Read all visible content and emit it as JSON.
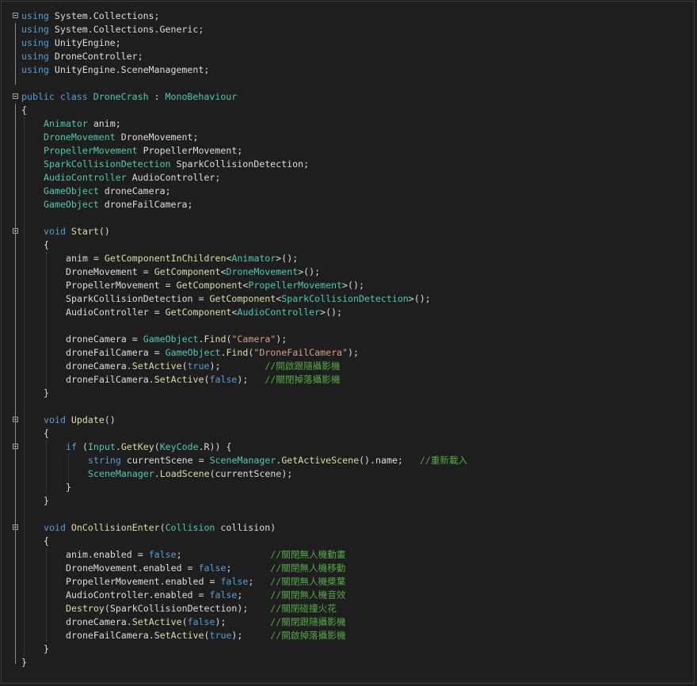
{
  "editor": {
    "lines": [
      [
        {
          "t": "using",
          "c": "kw"
        },
        {
          "t": " System.Collections;",
          "c": "pl"
        }
      ],
      [
        {
          "t": "using",
          "c": "kw"
        },
        {
          "t": " System.Collections.Generic;",
          "c": "pl"
        }
      ],
      [
        {
          "t": "using",
          "c": "kw"
        },
        {
          "t": " UnityEngine;",
          "c": "pl"
        }
      ],
      [
        {
          "t": "using",
          "c": "kw"
        },
        {
          "t": " DroneController;",
          "c": "pl"
        }
      ],
      [
        {
          "t": "using",
          "c": "kw"
        },
        {
          "t": " UnityEngine.SceneManagement;",
          "c": "pl"
        }
      ],
      [],
      [
        {
          "t": "public class ",
          "c": "kw"
        },
        {
          "t": "DroneCrash",
          "c": "ty"
        },
        {
          "t": " : ",
          "c": "pl"
        },
        {
          "t": "MonoBehaviour",
          "c": "ty"
        }
      ],
      [
        {
          "t": "{",
          "c": "pl"
        }
      ],
      [
        {
          "t": "Animator",
          "c": "ty"
        },
        {
          "t": " anim;",
          "c": "pl"
        }
      ],
      [
        {
          "t": "DroneMovement",
          "c": "ty"
        },
        {
          "t": " DroneMovement;",
          "c": "pl"
        }
      ],
      [
        {
          "t": "PropellerMovement",
          "c": "ty"
        },
        {
          "t": " PropellerMovement;",
          "c": "pl"
        }
      ],
      [
        {
          "t": "SparkCollisionDetection",
          "c": "ty"
        },
        {
          "t": " SparkCollisionDetection;",
          "c": "pl"
        }
      ],
      [
        {
          "t": "AudioController",
          "c": "ty"
        },
        {
          "t": " AudioController;",
          "c": "pl"
        }
      ],
      [
        {
          "t": "GameObject",
          "c": "ty"
        },
        {
          "t": " droneCamera;",
          "c": "pl"
        }
      ],
      [
        {
          "t": "GameObject",
          "c": "ty"
        },
        {
          "t": " droneFailCamera;",
          "c": "pl"
        }
      ],
      [],
      [
        {
          "t": "void ",
          "c": "kw"
        },
        {
          "t": "Start",
          "c": "fn"
        },
        {
          "t": "()",
          "c": "pl"
        }
      ],
      [
        {
          "t": "{",
          "c": "pl"
        }
      ],
      [
        {
          "t": "anim = ",
          "c": "pl"
        },
        {
          "t": "GetComponentInChildren",
          "c": "fn"
        },
        {
          "t": "<",
          "c": "pl"
        },
        {
          "t": "Animator",
          "c": "ty"
        },
        {
          "t": ">();",
          "c": "pl"
        }
      ],
      [
        {
          "t": "DroneMovement = ",
          "c": "pl"
        },
        {
          "t": "GetComponent",
          "c": "fn"
        },
        {
          "t": "<",
          "c": "pl"
        },
        {
          "t": "DroneMovement",
          "c": "ty"
        },
        {
          "t": ">();",
          "c": "pl"
        }
      ],
      [
        {
          "t": "PropellerMovement = ",
          "c": "pl"
        },
        {
          "t": "GetComponent",
          "c": "fn"
        },
        {
          "t": "<",
          "c": "pl"
        },
        {
          "t": "PropellerMovement",
          "c": "ty"
        },
        {
          "t": ">();",
          "c": "pl"
        }
      ],
      [
        {
          "t": "SparkCollisionDetection = ",
          "c": "pl"
        },
        {
          "t": "GetComponent",
          "c": "fn"
        },
        {
          "t": "<",
          "c": "pl"
        },
        {
          "t": "SparkCollisionDetection",
          "c": "ty"
        },
        {
          "t": ">();",
          "c": "pl"
        }
      ],
      [
        {
          "t": "AudioController = ",
          "c": "pl"
        },
        {
          "t": "GetComponent",
          "c": "fn"
        },
        {
          "t": "<",
          "c": "pl"
        },
        {
          "t": "AudioController",
          "c": "ty"
        },
        {
          "t": ">();",
          "c": "pl"
        }
      ],
      [],
      [
        {
          "t": "droneCamera = ",
          "c": "pl"
        },
        {
          "t": "GameObject",
          "c": "ty"
        },
        {
          "t": ".",
          "c": "pl"
        },
        {
          "t": "Find",
          "c": "fn"
        },
        {
          "t": "(",
          "c": "pl"
        },
        {
          "t": "\"Camera\"",
          "c": "st"
        },
        {
          "t": ");",
          "c": "pl"
        }
      ],
      [
        {
          "t": "droneFailCamera = ",
          "c": "pl"
        },
        {
          "t": "GameObject",
          "c": "ty"
        },
        {
          "t": ".",
          "c": "pl"
        },
        {
          "t": "Find",
          "c": "fn"
        },
        {
          "t": "(",
          "c": "pl"
        },
        {
          "t": "\"DroneFailCamera\"",
          "c": "st"
        },
        {
          "t": ");",
          "c": "pl"
        }
      ],
      [
        {
          "t": "droneCamera.",
          "c": "pl"
        },
        {
          "t": "SetActive",
          "c": "fn"
        },
        {
          "t": "(",
          "c": "pl"
        },
        {
          "t": "true",
          "c": "kw"
        },
        {
          "t": ");        ",
          "c": "pl"
        },
        {
          "t": "//開啟跟隨攝影機",
          "c": "cm"
        }
      ],
      [
        {
          "t": "droneFailCamera.",
          "c": "pl"
        },
        {
          "t": "SetActive",
          "c": "fn"
        },
        {
          "t": "(",
          "c": "pl"
        },
        {
          "t": "false",
          "c": "kw"
        },
        {
          "t": ");   ",
          "c": "pl"
        },
        {
          "t": "//關閉掉落攝影機",
          "c": "cm"
        }
      ],
      [
        {
          "t": "}",
          "c": "pl"
        }
      ],
      [],
      [
        {
          "t": "void ",
          "c": "kw"
        },
        {
          "t": "Update",
          "c": "fn"
        },
        {
          "t": "()",
          "c": "pl"
        }
      ],
      [
        {
          "t": "{",
          "c": "pl"
        }
      ],
      [
        {
          "t": "if",
          "c": "kw"
        },
        {
          "t": " (",
          "c": "pl"
        },
        {
          "t": "Input",
          "c": "ty"
        },
        {
          "t": ".",
          "c": "pl"
        },
        {
          "t": "GetKey",
          "c": "fn"
        },
        {
          "t": "(",
          "c": "pl"
        },
        {
          "t": "KeyCode",
          "c": "ty"
        },
        {
          "t": ".R)) {",
          "c": "pl"
        }
      ],
      [
        {
          "t": "string ",
          "c": "kw"
        },
        {
          "t": "currentScene = ",
          "c": "pl"
        },
        {
          "t": "SceneManager",
          "c": "ty"
        },
        {
          "t": ".",
          "c": "pl"
        },
        {
          "t": "GetActiveScene",
          "c": "fn"
        },
        {
          "t": "().name;   ",
          "c": "pl"
        },
        {
          "t": "//重新載入",
          "c": "cm"
        }
      ],
      [
        {
          "t": "SceneManager",
          "c": "ty"
        },
        {
          "t": ".",
          "c": "pl"
        },
        {
          "t": "LoadScene",
          "c": "fn"
        },
        {
          "t": "(currentScene);",
          "c": "pl"
        }
      ],
      [
        {
          "t": "}",
          "c": "pl"
        }
      ],
      [
        {
          "t": "}",
          "c": "pl"
        }
      ],
      [],
      [
        {
          "t": "void ",
          "c": "kw"
        },
        {
          "t": "OnCollisionEnter",
          "c": "fn"
        },
        {
          "t": "(",
          "c": "pl"
        },
        {
          "t": "Collision",
          "c": "ty"
        },
        {
          "t": " collision)",
          "c": "pl"
        }
      ],
      [
        {
          "t": "{",
          "c": "pl"
        }
      ],
      [
        {
          "t": "anim.enabled = ",
          "c": "pl"
        },
        {
          "t": "false",
          "c": "kw"
        },
        {
          "t": ";                ",
          "c": "pl"
        },
        {
          "t": "//關閉無人機動畫",
          "c": "cm"
        }
      ],
      [
        {
          "t": "DroneMovement.enabled = ",
          "c": "pl"
        },
        {
          "t": "false",
          "c": "kw"
        },
        {
          "t": ";       ",
          "c": "pl"
        },
        {
          "t": "//關閉無人機移動",
          "c": "cm"
        }
      ],
      [
        {
          "t": "PropellerMovement.enabled = ",
          "c": "pl"
        },
        {
          "t": "false",
          "c": "kw"
        },
        {
          "t": ";   ",
          "c": "pl"
        },
        {
          "t": "//關閉無人機槳葉",
          "c": "cm"
        }
      ],
      [
        {
          "t": "AudioController.enabled = ",
          "c": "pl"
        },
        {
          "t": "false",
          "c": "kw"
        },
        {
          "t": ";     ",
          "c": "pl"
        },
        {
          "t": "//關閉無人機音效",
          "c": "cm"
        }
      ],
      [
        {
          "t": "Destroy",
          "c": "fn"
        },
        {
          "t": "(SparkCollisionDetection);    ",
          "c": "pl"
        },
        {
          "t": "//關閉碰撞火花",
          "c": "cm"
        }
      ],
      [
        {
          "t": "droneCamera.",
          "c": "pl"
        },
        {
          "t": "SetActive",
          "c": "fn"
        },
        {
          "t": "(",
          "c": "pl"
        },
        {
          "t": "false",
          "c": "kw"
        },
        {
          "t": ");        ",
          "c": "pl"
        },
        {
          "t": "//關閉跟隨攝影機",
          "c": "cm"
        }
      ],
      [
        {
          "t": "droneFailCamera.",
          "c": "pl"
        },
        {
          "t": "SetActive",
          "c": "fn"
        },
        {
          "t": "(",
          "c": "pl"
        },
        {
          "t": "true",
          "c": "kw"
        },
        {
          "t": ");     ",
          "c": "pl"
        },
        {
          "t": "//開啟掉落攝影機",
          "c": "cm"
        }
      ],
      [
        {
          "t": "}",
          "c": "pl"
        }
      ],
      [
        {
          "t": "}",
          "c": "pl"
        }
      ]
    ]
  }
}
